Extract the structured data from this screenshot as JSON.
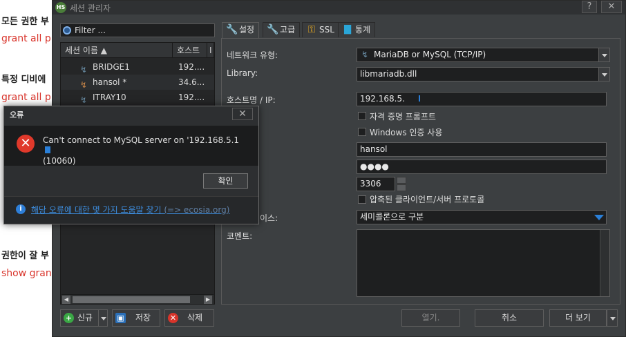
{
  "background_page": {
    "headings": [
      "모든 권한 부",
      "특정 디비에",
      "권한이 잘 부"
    ],
    "code_lines": [
      "grant all p",
      "grant all p",
      "show gran"
    ]
  },
  "window": {
    "title": "세션 관리자",
    "help_button": "?",
    "close_button": "✕",
    "app_icon_text": "HS"
  },
  "filter": {
    "placeholder": "Filter ..."
  },
  "session_list": {
    "columns": [
      "세션 이름 ▲",
      "호스트",
      "I"
    ],
    "rows": [
      {
        "name": "BRIDGE1",
        "host": "192...."
      },
      {
        "name": "hansol *",
        "host": "34.6..."
      },
      {
        "name": "ITRAY10",
        "host": "192...."
      }
    ]
  },
  "tabs": [
    {
      "label": "설정",
      "icon": "wrench-icon",
      "active": true
    },
    {
      "label": "고급",
      "icon": "wrench-orange-icon",
      "active": false
    },
    {
      "label": "SSL",
      "icon": "key-icon",
      "active": false
    },
    {
      "label": "통계",
      "icon": "bar-chart-icon",
      "active": false
    }
  ],
  "settings": {
    "network_type_label": "네트워크 유형:",
    "network_type_value": "MariaDB or MySQL (TCP/IP)",
    "library_label": "Library:",
    "library_value": "libmariadb.dll",
    "host_label": "호스트명 / IP:",
    "host_value": "192.168.5.",
    "prompt_credentials": "자격 증명 프롬프트",
    "windows_auth": "Windows 인증 사용",
    "user_value": "hansol",
    "password_value": "●●●●",
    "port_value": "3306",
    "compressed_protocol": "압축된 클라이언트/서버 프로토콜",
    "databases_label": "이스:",
    "databases_value": "세미콜론으로 구분",
    "comment_label": "코멘트:"
  },
  "bottom_buttons": {
    "new": "신규",
    "save": "저장",
    "delete": "삭제",
    "open": "열기.",
    "cancel": "취소",
    "more": "더 보기"
  },
  "error_dialog": {
    "title": "오류",
    "message": "Can't connect to MySQL server on '192.168.5.1",
    "code": "(10060)",
    "ok_button": "확인",
    "help_link": "해당 오류에 대한 몇 가지 도움말 찾기",
    "help_link_sub": "(=> ecosia.org)"
  },
  "colors": {
    "window_bg": "#3c3f41",
    "field_bg": "#1e1f20",
    "error_red": "#e0392b",
    "link_blue": "#3d8ee0",
    "background_code_red": "#d9342b"
  }
}
